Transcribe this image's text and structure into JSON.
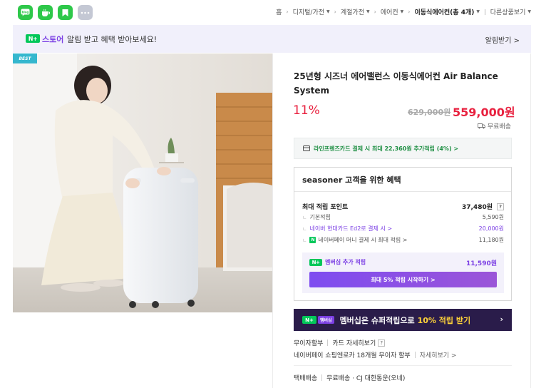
{
  "share": {
    "icons": [
      {
        "name": "blog-share-icon",
        "label": "blog",
        "color": "#2ec84a"
      },
      {
        "name": "cafe-share-icon",
        "label": "cafe",
        "color": "#2ec84a"
      },
      {
        "name": "bookmark-share-icon",
        "label": "keep",
        "color": "#2ec84a"
      },
      {
        "name": "more-share-icon",
        "label": "more",
        "color": "#c4c8d4"
      }
    ]
  },
  "breadcrumb": {
    "items": [
      "홈",
      "디지털/가전",
      "계절가전",
      "에어컨",
      "이동식에어컨(총 4개)",
      "다른상품보기"
    ]
  },
  "notice": {
    "badge": "N+",
    "store": "스토어",
    "text": "알림 받고 혜택 받아보세요!",
    "button": "알림받기 >"
  },
  "image": {
    "badge": "BEST"
  },
  "product": {
    "title": "25년형 시즈너 에어밸런스 이동식에어컨 Air Balance System",
    "discount": "11%",
    "original_price": "629,000원",
    "sale_price": "559,000원",
    "shipping": "무료배송"
  },
  "card_benefit": {
    "text": "라인프렌즈카드 결제 시 최대 22,360원 추가적립 (4%) >"
  },
  "benefits": {
    "heading": "seasoner 고객을 위한 혜택",
    "max_label": "최대 적립 포인트",
    "max_value": "37,480원",
    "qmark": "?",
    "rows": [
      {
        "label": "기본적립",
        "value": "5,590원"
      },
      {
        "label": "네이버 현대카드 Ed2로 결제 시 >",
        "value": "20,000원"
      },
      {
        "label": "네이버페이 머니 결제 시 최대 적립 >",
        "value": "11,180원"
      }
    ],
    "membership_label": "멤버십 추가 적립",
    "membership_badge": "N+",
    "membership_value": "11,590원",
    "start_button": "최대 5% 적립 시작하기 >"
  },
  "super_banner": {
    "badge1": "N+",
    "badge2": "멤버십",
    "text": "멤버십은 슈퍼적립으로",
    "highlight": "10% 적립 받기",
    "arrow": "›"
  },
  "installment": {
    "label": "무이자할부",
    "link": "카드 자세히보기",
    "qmark": "?",
    "line2": "네이버페이 쇼핑엔로카 18개월 무이자 할부",
    "line2_link": "자세히보기 >"
  },
  "delivery": {
    "label": "택배배송",
    "text": "무료배송 · CJ 대한통운(오네)"
  },
  "colors": {
    "accent_green": "#03c75a",
    "price_red": "#e8213f",
    "membership_purple": "#7b3fe4"
  }
}
